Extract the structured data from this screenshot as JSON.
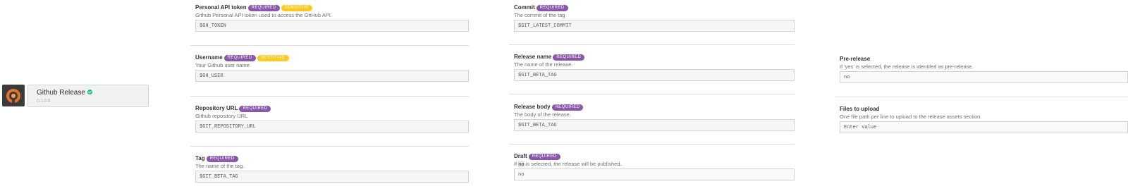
{
  "step": {
    "title": "Github Release",
    "version": "0.10.0"
  },
  "left_column": [
    {
      "label": "Personal API token",
      "badges": [
        "REQUIRED",
        "SENSITIVE"
      ],
      "description": "Github Personal API token used to access the GitHub API.",
      "value": "$GH_TOKEN"
    },
    {
      "label": "Username",
      "badges": [
        "REQUIRED",
        "SENSITIVE"
      ],
      "description": "Your Github user name",
      "value": "$GH_USER"
    },
    {
      "label": "Repository URL",
      "badges": [
        "REQUIRED"
      ],
      "description": "Github repository URL",
      "value": "$GIT_REPOSITORY_URL"
    },
    {
      "label": "Tag",
      "badges": [
        "REQUIRED"
      ],
      "description": "The name of the tag.",
      "value": "$GIT_BETA_TAG"
    }
  ],
  "middle_column": [
    {
      "label": "Commit",
      "badges": [
        "REQUIRED"
      ],
      "description": "The commit of the tag",
      "value": "$GIT_LATEST_COMMIT"
    },
    {
      "label": "Release name",
      "badges": [
        "REQUIRED"
      ],
      "description": "The name of the release.",
      "value": "$GIT_BETA_TAG"
    },
    {
      "label": "Release body",
      "badges": [
        "REQUIRED"
      ],
      "description": "The body of the release.",
      "value": "$GIT_BETA_TAG"
    },
    {
      "label": "Draft",
      "badges": [
        "REQUIRED"
      ],
      "description_prefix": "If ",
      "description_highlight": "no",
      "description_suffix": " is selected, the release will be published.",
      "value": "no"
    }
  ],
  "right_column": [
    {
      "label": "Pre-release",
      "description": "If 'yes' is selected, the release is identifed as pre-release.",
      "value": "no"
    },
    {
      "label": "Files to upload",
      "description": "One file path per line to upload to the release assets section.",
      "placeholder": "Enter value"
    }
  ]
}
